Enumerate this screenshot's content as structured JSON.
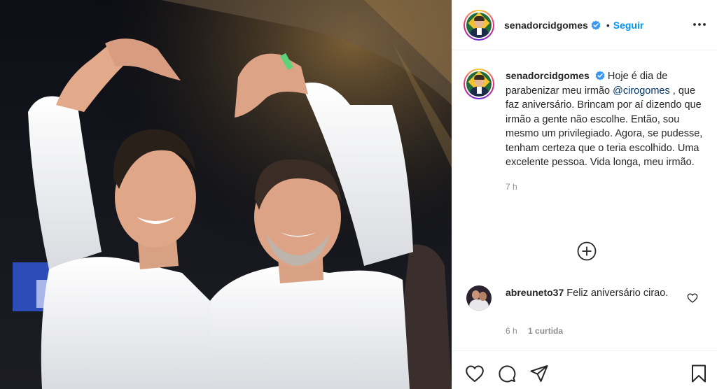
{
  "post": {
    "author": "senadorcidgomes",
    "follow_label": "Seguir",
    "separator": "•"
  },
  "caption": {
    "author": "senadorcidgomes",
    "text_before": "Hoje é dia de parabenizar meu irmão",
    "mention": "@cirogomes",
    "text_after": ", que faz aniversário. Brincam por aí dizendo que irmão a gente não escolhe. Então, sou mesmo um privilegiado. Agora, se pudesse, tenham certeza que o teria escolhido. Uma excelente pessoa. Vida longa, meu irmão.",
    "time": "7 h"
  },
  "comments": [
    {
      "author": "abreuneto37",
      "text": "Feliz aniversário cirao.",
      "time": "6 h",
      "likes": "1 curtida"
    }
  ],
  "icons": {
    "verified": "verified-badge-icon",
    "more": "more-options-icon",
    "add_comment": "plus-circle-icon",
    "like": "heart-icon",
    "comment": "speech-bubble-icon",
    "share": "paper-plane-icon",
    "save": "bookmark-icon"
  },
  "colors": {
    "link_blue": "#0095f6",
    "mention": "#00376b",
    "muted": "#8e8e8e",
    "text": "#262626"
  }
}
